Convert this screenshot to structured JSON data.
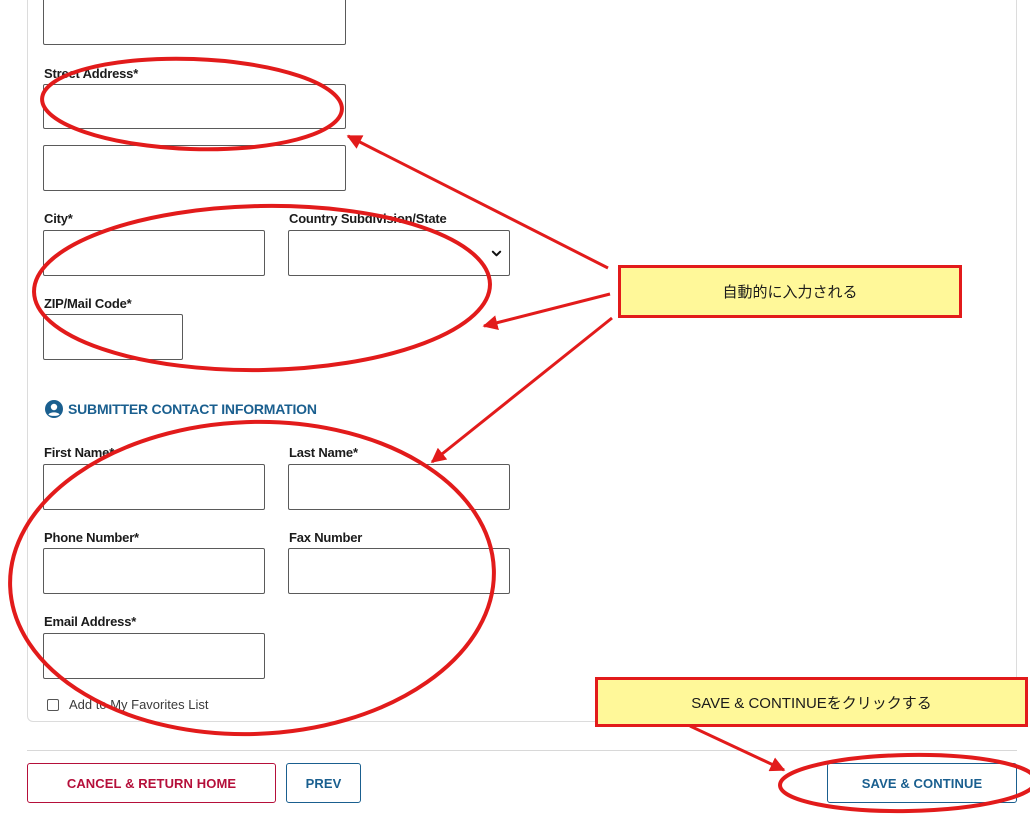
{
  "form": {
    "street_address_label": "Street Address*",
    "city_label": "City*",
    "state_label": "Country Subdivision/State",
    "zip_label": "ZIP/Mail Code*",
    "section_title": "SUBMITTER CONTACT INFORMATION",
    "first_name_label": "First Name*",
    "last_name_label": "Last Name*",
    "phone_label": "Phone Number*",
    "fax_label": "Fax Number",
    "email_label": "Email Address*",
    "favorites_label": "Add to My Favorites List",
    "favorites_checked": false
  },
  "footer": {
    "cancel_label": "CANCEL & RETURN HOME",
    "prev_label": "PREV",
    "save_label": "SAVE & CONTINUE"
  },
  "annotations": {
    "callout_autofill": "自動的に入力される",
    "callout_save": "SAVE & CONTINUEをクリックする",
    "ink_color": "#e21b1b",
    "callout_fill": "#fff899"
  },
  "colors": {
    "accent_blue": "#1a5f8f",
    "danger_red": "#b50f3a"
  }
}
